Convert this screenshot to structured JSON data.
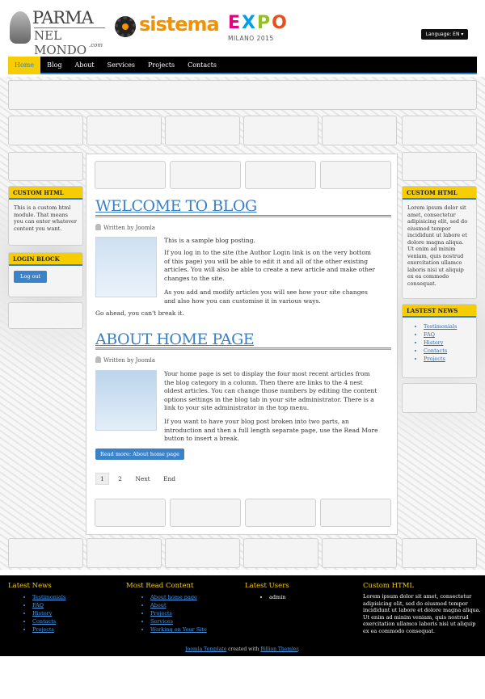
{
  "header": {
    "logo1_line1": "PARMA",
    "logo1_line2": "NEL MONDO",
    "logo1_com": ".com",
    "logo2": "sistema",
    "logo3_letters": [
      "E",
      "X",
      "P",
      "O"
    ],
    "logo3_sub": "MILANO 2015",
    "language": "Language: EN ▾"
  },
  "nav": [
    "Home",
    "Blog",
    "About",
    "Services",
    "Projects",
    "Contacts"
  ],
  "left": {
    "custom_title": "CUSTOM HTML",
    "custom_text": "This is a custom html module. That means you can enter whatever content you want.",
    "login_title": "LOGIN BLOCK",
    "login_button": "Log out"
  },
  "right": {
    "custom_title": "CUSTOM HTML",
    "custom_text": "Lorem ipsum dolor sit amet, consectetur adipisicing elit, sed do eiusmod tempor incididunt ut labore et dolore magna aliqua. Ut enim ad minim veniam, quis nostrud exercitation ullamco laboris nisi ut aliquip ex ea commodo consequat.",
    "news_title": "LASTEST NEWS",
    "news": [
      "Testimonials",
      "FAQ",
      "History",
      "Contacts",
      "Projects"
    ]
  },
  "article1": {
    "title": "WELCOME TO BLOG",
    "author": "Written by Joomla",
    "p1": "This is a sample blog posting.",
    "p2": "If you log in to the site (the Author Login link is on the very bottom of this page) you will be able to edit it and all of the other existing articles. You will also be able to create a new article and make other changes to the site.",
    "p3": "As you add and modify articles you will see how your site changes and also how you can customise it in various ways.",
    "p4": "Go ahead, you can't break it."
  },
  "article2": {
    "title": "ABOUT HOME PAGE",
    "author": "Written by Joomla",
    "p1": "Your home page is set to display the four most recent articles from the blog category in a column. Then there are links to the 4 nest oldest articles. You can change those numbers by editing the content options settings in the blog tab in your site administrator. There is a link to your site administrator in the top menu.",
    "p2": "If you want to have your blog post broken into two parts, an introduction and then a full length separate page, use the Read More button to insert a break.",
    "readmore": "Read more: About home page"
  },
  "pagination": [
    "1",
    "2",
    "Next",
    "End"
  ],
  "footer": {
    "col1_title": "Latest News",
    "col1": [
      "Testimonials",
      "FAQ",
      "History",
      "Contacts",
      "Projects"
    ],
    "col2_title": "Most Read Content",
    "col2": [
      "About home page",
      "About",
      "Projects",
      "Services",
      "Working on Your Site"
    ],
    "col3_title": "Latest Users",
    "col3": [
      "admin"
    ],
    "col4_title": "Custom HTML",
    "col4_text": "Lorem ipsum dolor sit amet, consectetur adipisicing elit, sed do eiusmod tempor incididunt ut labore et dolore magna aliqua. Ut enim ad minim veniam, quis nostrud exercitation ullamco laboris nisi ut aliquip ex ea commodo consequat.",
    "credit_link1": "Joomla Template",
    "credit_mid": " created with ",
    "credit_link2": "Billion Themler",
    "credit_end": "."
  },
  "colors": {
    "accent": "#f5cd00",
    "link": "#3a80c8",
    "nav_bg": "#000000"
  }
}
